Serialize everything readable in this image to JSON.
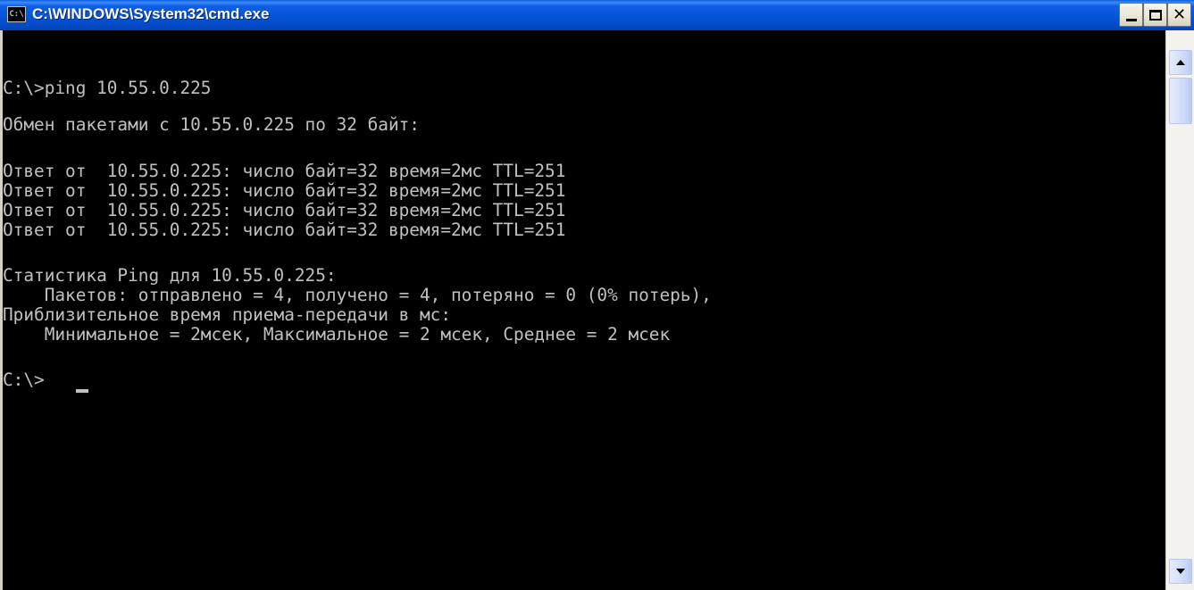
{
  "window": {
    "title": "C:\\WINDOWS\\System32\\cmd.exe",
    "icon": "cmd-icon",
    "icon_label": "C:\\"
  },
  "console": {
    "lines": [
      "C:\\>ping 10.55.0.225",
      "Обмен пакетами с 10.55.0.225 по 32 байт:",
      "Ответ от  10.55.0.225: число байт=32 время=2мс TTL=251",
      "Ответ от  10.55.0.225: число байт=32 время=2мс TTL=251",
      "Ответ от  10.55.0.225: число байт=32 время=2мс TTL=251",
      "Ответ от  10.55.0.225: число байт=32 время=2мс TTL=251",
      "Статистика Ping для 10.55.0.225:",
      "    Пакетов: отправлено = 4, получено = 4, потеряно = 0 (0% потерь),",
      "Приблизительное время приема-передачи в мс:",
      "    Минимальное = 2мсек, Максимальное = 2 мсек, Среднее = 2 мсек",
      "C:\\>"
    ]
  },
  "colors": {
    "console_bg": "#000000",
    "console_text": "#c0c0c0",
    "titlebar": "#0554d8"
  },
  "icons": {
    "minimize": "minimize-icon",
    "maximize": "maximize-icon",
    "close": "close-icon",
    "scroll_up": "arrow-up-icon",
    "scroll_down": "arrow-down-icon"
  }
}
